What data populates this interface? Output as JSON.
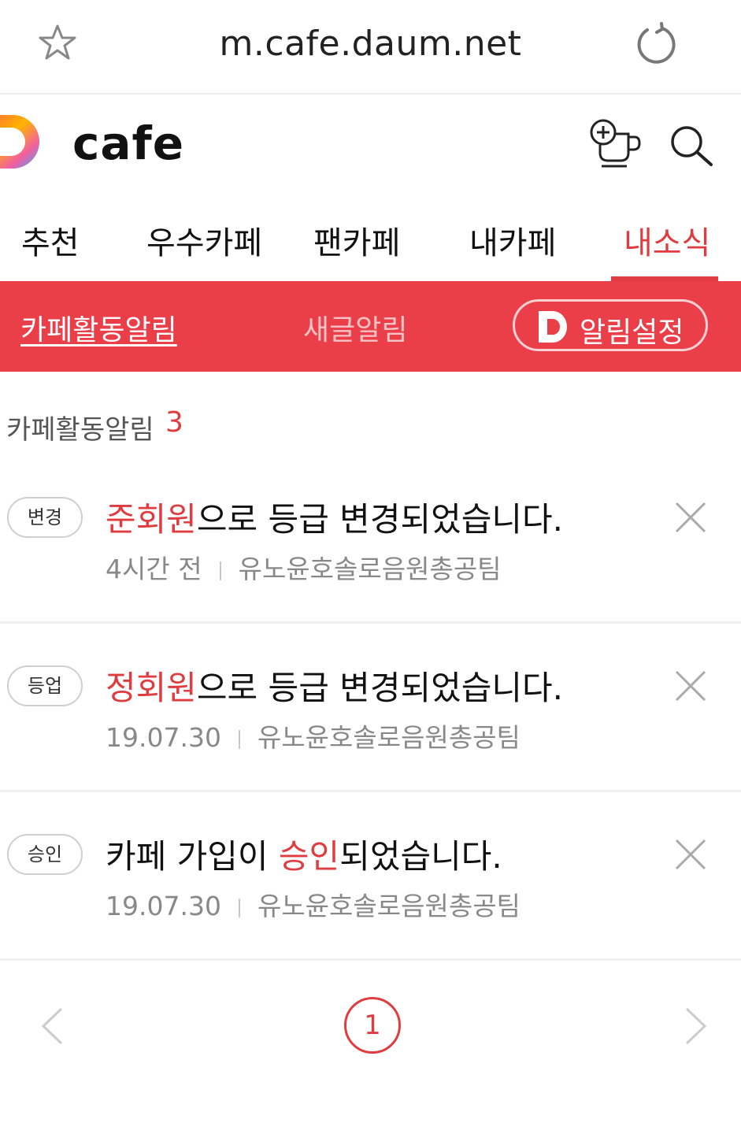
{
  "browser": {
    "url": "m.cafe.daum.net",
    "star_icon": "star-outline-icon",
    "reload_icon": "reload-icon"
  },
  "header": {
    "brand": "cafe",
    "icons": [
      "cafe-add-icon",
      "search-icon"
    ]
  },
  "tabs": [
    {
      "label": "추천",
      "active": false
    },
    {
      "label": "우수카페",
      "active": false
    },
    {
      "label": "팬카페",
      "active": false
    },
    {
      "label": "내카페",
      "active": false
    },
    {
      "label": "내소식",
      "active": true
    }
  ],
  "subnav": {
    "items": [
      "카페활동알림",
      "새글알림"
    ],
    "alarm_settings": "알림설정"
  },
  "section": {
    "title": "카페활동알림",
    "count": "3"
  },
  "notifications": [
    {
      "badge": "변경",
      "highlight": "준회원",
      "text": "으로 등급 변경되었습니다.",
      "time": "4시간 전",
      "cafe": "유노윤호솔로음원총공팀"
    },
    {
      "badge": "등업",
      "highlight": "정회원",
      "text": "으로 등급 변경되었습니다.",
      "time": "19.07.30",
      "cafe": "유노윤호솔로음원총공팀"
    },
    {
      "badge": "승인",
      "prefix": "카페 가입이 ",
      "highlight": "승인",
      "text": "되었습니다.",
      "time": "19.07.30",
      "cafe": "유노윤호솔로음원총공팀"
    }
  ],
  "pagination": {
    "current": "1"
  },
  "colors": {
    "accent": "#e03b3f",
    "subnav_bg": "#ea3e49"
  }
}
